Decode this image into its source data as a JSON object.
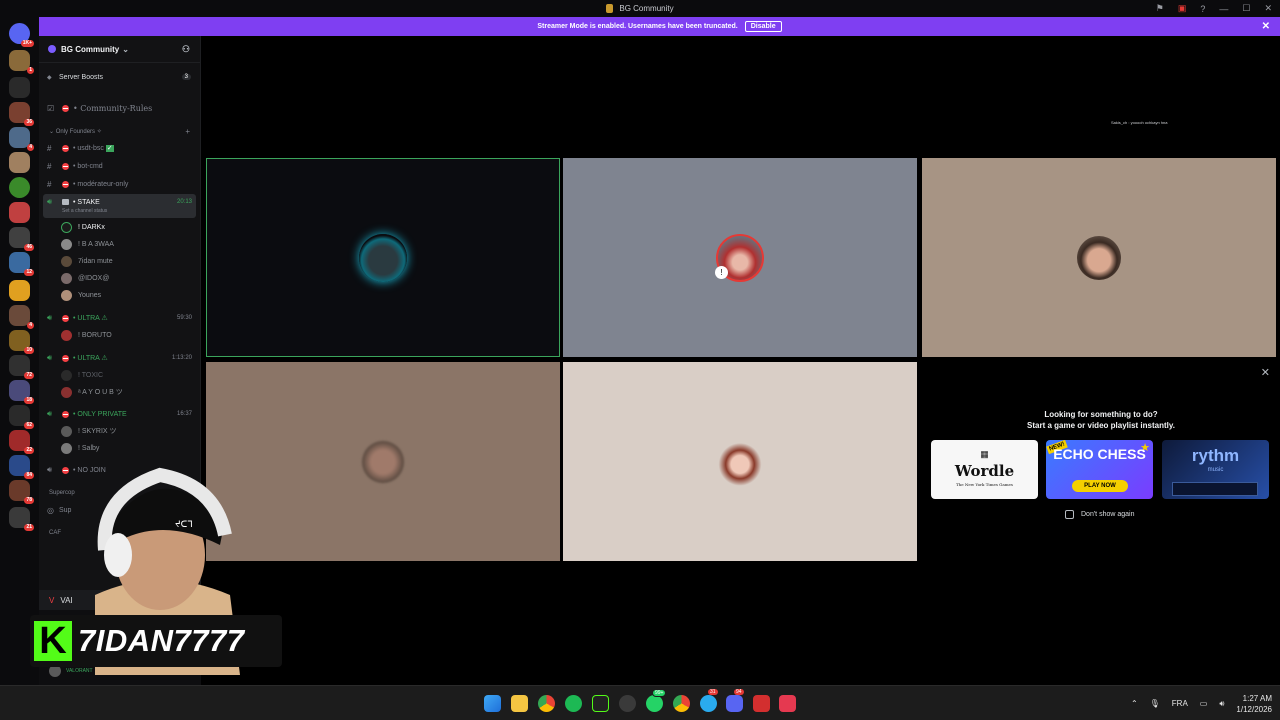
{
  "window": {
    "title": "BG Community"
  },
  "banner": {
    "text": "Streamer Mode is enabled. Usernames have been truncated.",
    "button": "Disable"
  },
  "server": {
    "name": "BG Community"
  },
  "sidebar": {
    "boosts_label": "Server Boosts",
    "boosts_count": "3",
    "rules": "Community-Rules",
    "category": "Only Founders",
    "channels": [
      {
        "name": "usdt-bsc"
      },
      {
        "name": "bot-cmd"
      },
      {
        "name": "modérateur-only"
      }
    ],
    "stake": {
      "name": "STAKE",
      "time": "20:13",
      "status": "Set a channel status"
    },
    "stake_users": [
      "! DARKx",
      "! B A 3WAA",
      "7idan mute",
      "@IDOX@",
      "Younes"
    ],
    "ultra1": {
      "name": "ULTRA ⚠",
      "time": "59:30",
      "users": [
        "! BORUTO"
      ]
    },
    "ultra2": {
      "name": "ULTRA ⚠",
      "time": "1:13:20",
      "users": [
        "! TOXIC",
        "ᵃ A Y O U B ツ"
      ]
    },
    "private": {
      "name": "ONLY PRIVATE",
      "time": "16:37",
      "users": [
        "! SKYRIX ツ",
        "! Salby"
      ]
    },
    "nojoin": "NO JOIN",
    "cat2": "Supercop",
    "sup": "Sup",
    "caf": "CAF",
    "voice_label": "VAI",
    "bottom_user": "VALORANT"
  },
  "main": {
    "speaker_line": "Sakis_ch : yooooh ochkayn hna",
    "activity": {
      "line1": "Looking for something to do?",
      "line2": "Start a game or video playlist instantly.",
      "cards": [
        "Wordle",
        "ECHO CHESS",
        "rythm"
      ],
      "wordle_sub": "The New York Times Games",
      "echo_badge": "NEW!",
      "echo_btn": "PLAY NOW",
      "rythm_sub": "music",
      "dont_show": "Don't show again"
    }
  },
  "overlay": {
    "streamer_name": "7IDAN7777",
    "logo": "K"
  },
  "taskbar": {
    "lang": "FRA",
    "time": "1:27 AM",
    "date": "1/12/2026",
    "badges": {
      "whatsapp": "99+",
      "telegram": "31",
      "discord": "94"
    }
  },
  "colors": {
    "banner": "#7f3ff2",
    "speaking": "#3ba55c",
    "kick": "#53fc18"
  }
}
